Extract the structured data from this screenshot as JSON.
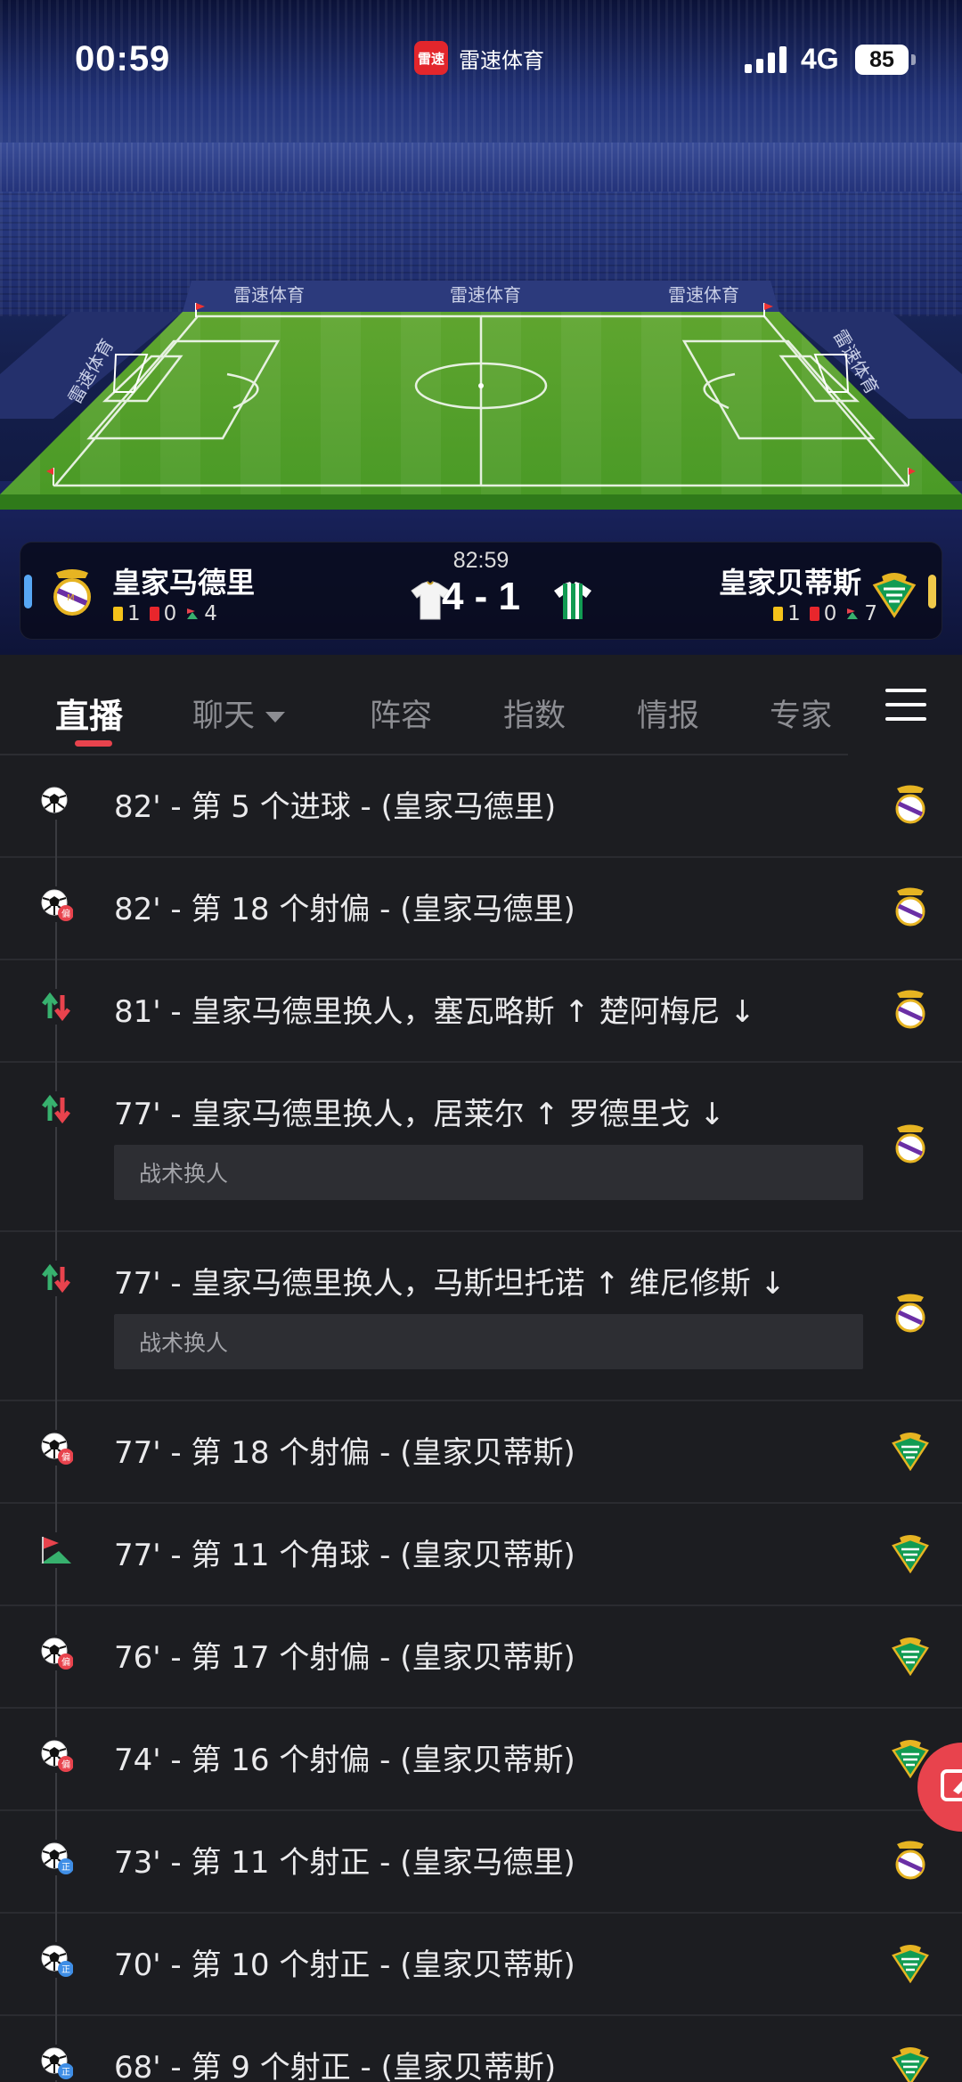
{
  "status_bar": {
    "time": "00:59",
    "network": "4G",
    "battery": "85"
  },
  "app": {
    "name": "雷速体育",
    "logo_text": "雷速"
  },
  "stadium": {
    "ad_boards": [
      "雷速体育",
      "雷速体育",
      "雷速体育",
      "雷速体育",
      "雷速体育"
    ]
  },
  "match": {
    "time": "82:59",
    "score": "4 - 1",
    "home": {
      "name": "皇家马德里",
      "yellow": "1",
      "red": "0",
      "corners": "4"
    },
    "away": {
      "name": "皇家贝蒂斯",
      "yellow": "1",
      "red": "0",
      "corners": "7"
    }
  },
  "tabs": [
    {
      "label": "直播",
      "active": true
    },
    {
      "label": "聊天",
      "active": false
    },
    {
      "label": "阵容",
      "active": false
    },
    {
      "label": "指数",
      "active": false
    },
    {
      "label": "情报",
      "active": false
    },
    {
      "label": "专家",
      "active": false
    }
  ],
  "events": [
    {
      "text": "82' - 第 5 个进球 - (皇家马德里)",
      "icon": "goal-icon",
      "team": "home"
    },
    {
      "text": "82' - 第 18 个射偏 - (皇家马德里)",
      "icon": "shot-off-target-icon",
      "badge": "偏",
      "team": "home"
    },
    {
      "text": "81' - 皇家马德里换人，塞瓦略斯 ↑ 楚阿梅尼 ↓",
      "icon": "substitution-icon",
      "team": "home"
    },
    {
      "text": "77' - 皇家马德里换人，居莱尔 ↑ 罗德里戈 ↓",
      "icon": "substitution-icon",
      "team": "home",
      "note": "战术换人"
    },
    {
      "text": "77' - 皇家马德里换人，马斯坦托诺 ↑ 维尼修斯 ↓",
      "icon": "substitution-icon",
      "team": "home",
      "note": "战术换人"
    },
    {
      "text": "77' - 第 18 个射偏 - (皇家贝蒂斯)",
      "icon": "shot-off-target-icon",
      "badge": "偏",
      "team": "away"
    },
    {
      "text": "77' - 第 11 个角球 - (皇家贝蒂斯)",
      "icon": "corner-flag-icon",
      "team": "away"
    },
    {
      "text": "76' - 第 17 个射偏 - (皇家贝蒂斯)",
      "icon": "shot-off-target-icon",
      "badge": "偏",
      "team": "away"
    },
    {
      "text": "74' - 第 16 个射偏 - (皇家贝蒂斯)",
      "icon": "shot-off-target-icon",
      "badge": "偏",
      "team": "away"
    },
    {
      "text": "73' - 第 11 个射正 - (皇家马德里)",
      "icon": "shot-on-target-icon",
      "badge": "正",
      "team": "home"
    },
    {
      "text": "70' - 第 10 个射正 - (皇家贝蒂斯)",
      "icon": "shot-on-target-icon",
      "badge": "正",
      "team": "away"
    },
    {
      "text": "68' - 第 9 个射正 - (皇家贝蒂斯)",
      "icon": "shot-on-target-icon",
      "badge": "正",
      "team": "away"
    }
  ],
  "colors": {
    "accent": "#e8434d",
    "home_bar": "#57a7f4",
    "away_bar": "#f0c94a",
    "background": "#1c1d21"
  }
}
